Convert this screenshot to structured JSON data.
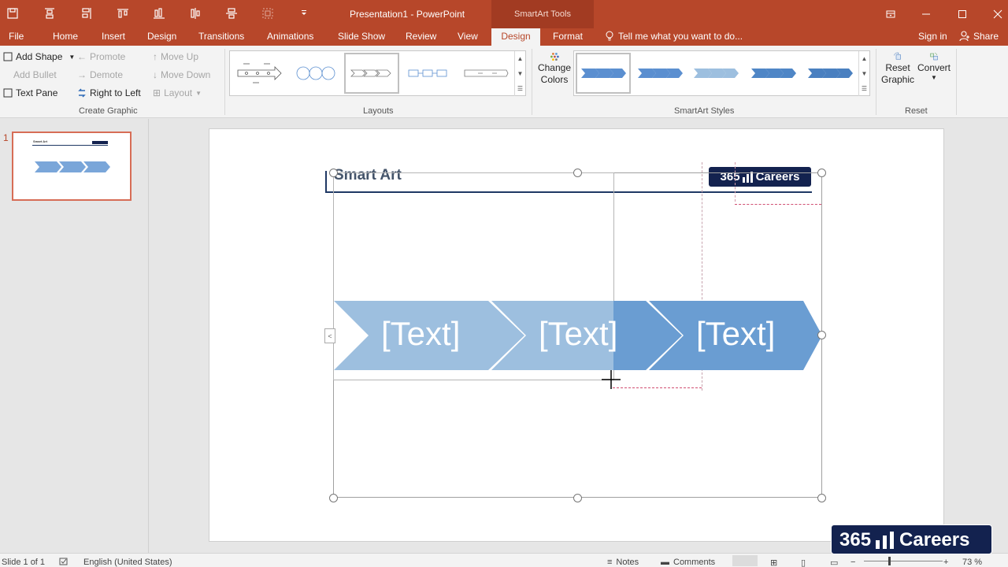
{
  "window": {
    "title": "Presentation1 - PowerPoint",
    "contextual_group": "SmartArt Tools"
  },
  "tabs": {
    "file": "File",
    "home": "Home",
    "insert": "Insert",
    "design": "Design",
    "transitions": "Transitions",
    "animations": "Animations",
    "slide_show": "Slide Show",
    "review": "Review",
    "view": "View",
    "smartart_design": "Design",
    "format": "Format",
    "tell_me": "Tell me what you want to do...",
    "sign_in": "Sign in",
    "share": "Share"
  },
  "ribbon": {
    "create_graphic": {
      "label": "Create Graphic",
      "add_shape": "Add Shape",
      "add_bullet": "Add Bullet",
      "text_pane": "Text Pane",
      "promote": "Promote",
      "demote": "Demote",
      "right_to_left": "Right to Left",
      "move_up": "Move Up",
      "move_down": "Move Down",
      "layout": "Layout"
    },
    "layouts": {
      "label": "Layouts"
    },
    "smartart_styles": {
      "label": "SmartArt Styles",
      "change_colors_1": "Change",
      "change_colors_2": "Colors"
    },
    "reset": {
      "label": "Reset",
      "reset_graphic_1": "Reset",
      "reset_graphic_2": "Graphic",
      "convert": "Convert"
    }
  },
  "thumbnails": {
    "slide_number": "1",
    "mini_title": "Smart Art",
    "mini_logo": "365 Careers"
  },
  "slide": {
    "title": "Smart Art",
    "logo_text": "365 ",
    "logo_text_2": "Careers",
    "chevrons": [
      {
        "text": "[Text]",
        "color": "#9dbfdf"
      },
      {
        "text": "[Text]",
        "color": "#9dbfdf"
      },
      {
        "text": "[Text]",
        "color": "#6a9dd2"
      }
    ]
  },
  "statusbar": {
    "slide_of": "Slide 1 of 1",
    "language": "English (United States)",
    "notes": "Notes",
    "comments": "Comments",
    "zoom": "73 %"
  },
  "watermark": {
    "text_1": "365",
    "text_2": "Careers"
  },
  "colors": {
    "accent": "#b7472a",
    "chevron_light": "#9dbfdf",
    "chevron_dark": "#6a9dd2",
    "logo_bg": "#13224f"
  }
}
